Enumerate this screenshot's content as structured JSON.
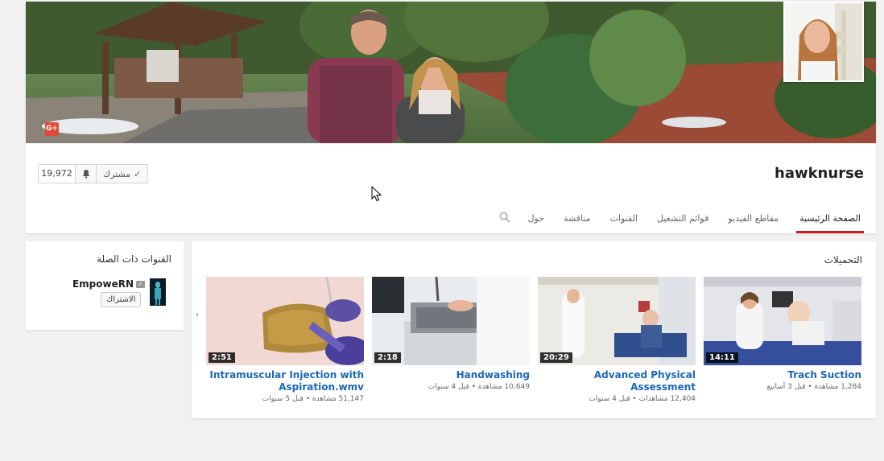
{
  "channel": {
    "name": "hawknurse",
    "subscriber_count": "19,972",
    "subscribed_label": "مشترك"
  },
  "tabs": [
    {
      "label": "الصفحة الرئيسية",
      "active": true
    },
    {
      "label": "مقاطع الفيديو"
    },
    {
      "label": "قوائم التشغيل"
    },
    {
      "label": "القنوات"
    },
    {
      "label": "مناقشة"
    },
    {
      "label": "حول"
    }
  ],
  "related": {
    "title": "القنوات ذات الصلة",
    "channel_name": "EmpoweRN",
    "subscribe_label": "الاشتراك"
  },
  "uploads": {
    "title": "التحميلات",
    "videos": [
      {
        "title": "Trach Suction",
        "duration": "14:11",
        "views": "1,284 مشاهدة",
        "age": "قبل 3 أسابيع"
      },
      {
        "title": "Advanced Physical Assessment",
        "duration": "20:29",
        "views": "12,404 مشاهدات",
        "age": "قبل 4 سنوات"
      },
      {
        "title": "Handwashing",
        "duration": "2:18",
        "views": "10,649 مشاهدة",
        "age": "قبل 4 سنوات"
      },
      {
        "title": "Intramuscular Injection with Aspiration.wmv",
        "duration": "2:51",
        "views": "51,147 مشاهدة",
        "age": "قبل 5 سنوات"
      }
    ]
  },
  "colors": {
    "accent_red": "#cc181e",
    "link_blue": "#1a67b5",
    "gplus_red": "#dd4b39"
  },
  "icons": {
    "gplus": "G+",
    "bell": "bell-icon",
    "check": "✓",
    "search": "search-icon",
    "prev": "‹"
  }
}
